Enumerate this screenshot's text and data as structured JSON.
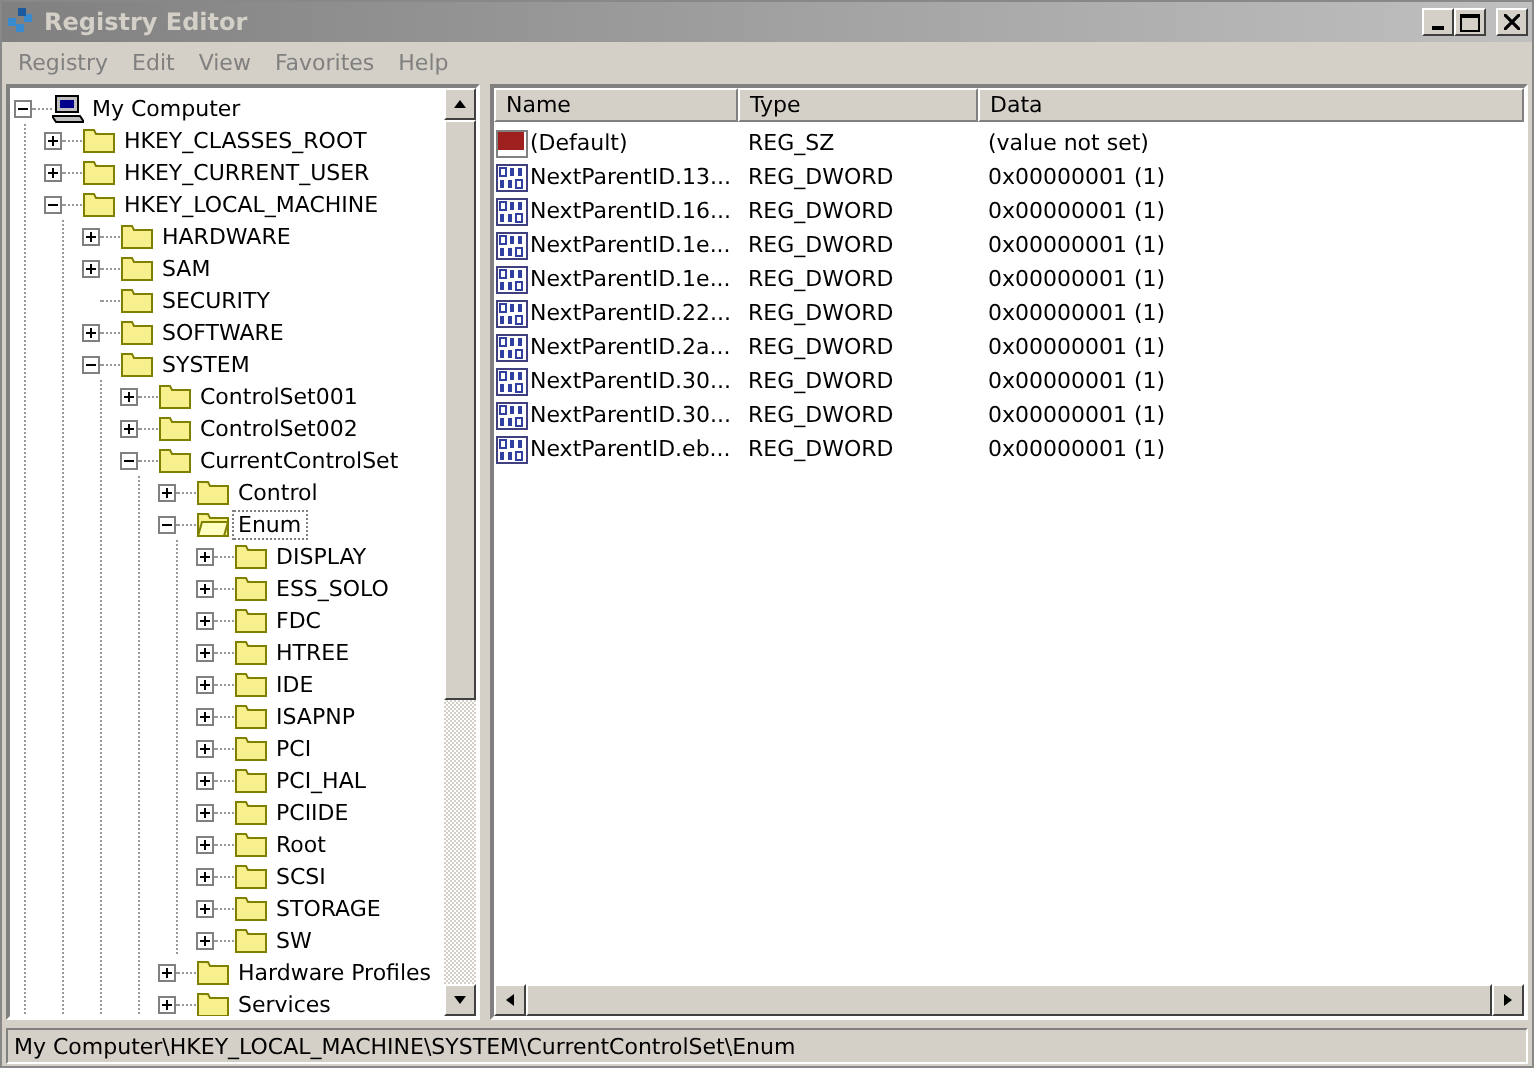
{
  "window": {
    "title": "Registry Editor",
    "active": false
  },
  "menu": [
    "Registry",
    "Edit",
    "View",
    "Favorites",
    "Help"
  ],
  "tree": [
    {
      "label": "My Computer",
      "kind": "computer",
      "expanded": true,
      "selected": false,
      "children": [
        {
          "label": "HKEY_CLASSES_ROOT",
          "kind": "folder",
          "expanded": false,
          "selected": false
        },
        {
          "label": "HKEY_CURRENT_USER",
          "kind": "folder",
          "expanded": false,
          "selected": false
        },
        {
          "label": "HKEY_LOCAL_MACHINE",
          "kind": "folder",
          "expanded": true,
          "selected": false,
          "children": [
            {
              "label": "HARDWARE",
              "kind": "folder",
              "expanded": false,
              "selected": false
            },
            {
              "label": "SAM",
              "kind": "folder",
              "expanded": false,
              "selected": false
            },
            {
              "label": "SECURITY",
              "kind": "leaf",
              "selected": false
            },
            {
              "label": "SOFTWARE",
              "kind": "folder",
              "expanded": false,
              "selected": false
            },
            {
              "label": "SYSTEM",
              "kind": "folder",
              "expanded": true,
              "selected": false,
              "children": [
                {
                  "label": "ControlSet001",
                  "kind": "folder",
                  "expanded": false,
                  "selected": false
                },
                {
                  "label": "ControlSet002",
                  "kind": "folder",
                  "expanded": false,
                  "selected": false
                },
                {
                  "label": "CurrentControlSet",
                  "kind": "folder",
                  "expanded": true,
                  "selected": false,
                  "children": [
                    {
                      "label": "Control",
                      "kind": "folder",
                      "expanded": false,
                      "selected": false
                    },
                    {
                      "label": "Enum",
                      "kind": "folder",
                      "expanded": true,
                      "selected": true,
                      "children": [
                        {
                          "label": "DISPLAY",
                          "kind": "folder",
                          "expanded": false,
                          "selected": false
                        },
                        {
                          "label": "ESS_SOLO",
                          "kind": "folder",
                          "expanded": false,
                          "selected": false
                        },
                        {
                          "label": "FDC",
                          "kind": "folder",
                          "expanded": false,
                          "selected": false
                        },
                        {
                          "label": "HTREE",
                          "kind": "folder",
                          "expanded": false,
                          "selected": false
                        },
                        {
                          "label": "IDE",
                          "kind": "folder",
                          "expanded": false,
                          "selected": false
                        },
                        {
                          "label": "ISAPNP",
                          "kind": "folder",
                          "expanded": false,
                          "selected": false
                        },
                        {
                          "label": "PCI",
                          "kind": "folder",
                          "expanded": false,
                          "selected": false
                        },
                        {
                          "label": "PCI_HAL",
                          "kind": "folder",
                          "expanded": false,
                          "selected": false
                        },
                        {
                          "label": "PCIIDE",
                          "kind": "folder",
                          "expanded": false,
                          "selected": false
                        },
                        {
                          "label": "Root",
                          "kind": "folder",
                          "expanded": false,
                          "selected": false
                        },
                        {
                          "label": "SCSI",
                          "kind": "folder",
                          "expanded": false,
                          "selected": false
                        },
                        {
                          "label": "STORAGE",
                          "kind": "folder",
                          "expanded": false,
                          "selected": false
                        },
                        {
                          "label": "SW",
                          "kind": "folder",
                          "expanded": false,
                          "selected": false
                        }
                      ]
                    },
                    {
                      "label": "Hardware Profiles",
                      "kind": "folder",
                      "expanded": false,
                      "selected": false
                    },
                    {
                      "label": "Services",
                      "kind": "folder",
                      "expanded": false,
                      "selected": false
                    }
                  ]
                }
              ]
            }
          ]
        }
      ]
    }
  ],
  "table": {
    "columns": [
      "Name",
      "Type",
      "Data"
    ],
    "rows": [
      {
        "kind": "string",
        "name": "(Default)",
        "type": "REG_SZ",
        "data": "(value not set)"
      },
      {
        "kind": "binary",
        "name": "NextParentID.13...",
        "type": "REG_DWORD",
        "data": "0x00000001 (1)"
      },
      {
        "kind": "binary",
        "name": "NextParentID.16...",
        "type": "REG_DWORD",
        "data": "0x00000001 (1)"
      },
      {
        "kind": "binary",
        "name": "NextParentID.1e...",
        "type": "REG_DWORD",
        "data": "0x00000001 (1)"
      },
      {
        "kind": "binary",
        "name": "NextParentID.1e...",
        "type": "REG_DWORD",
        "data": "0x00000001 (1)"
      },
      {
        "kind": "binary",
        "name": "NextParentID.22...",
        "type": "REG_DWORD",
        "data": "0x00000001 (1)"
      },
      {
        "kind": "binary",
        "name": "NextParentID.2a...",
        "type": "REG_DWORD",
        "data": "0x00000001 (1)"
      },
      {
        "kind": "binary",
        "name": "NextParentID.30...",
        "type": "REG_DWORD",
        "data": "0x00000001 (1)"
      },
      {
        "kind": "binary",
        "name": "NextParentID.30...",
        "type": "REG_DWORD",
        "data": "0x00000001 (1)"
      },
      {
        "kind": "binary",
        "name": "NextParentID.eb...",
        "type": "REG_DWORD",
        "data": "0x00000001 (1)"
      }
    ]
  },
  "status_bar": "My Computer\\HKEY_LOCAL_MACHINE\\SYSTEM\\CurrentControlSet\\Enum"
}
